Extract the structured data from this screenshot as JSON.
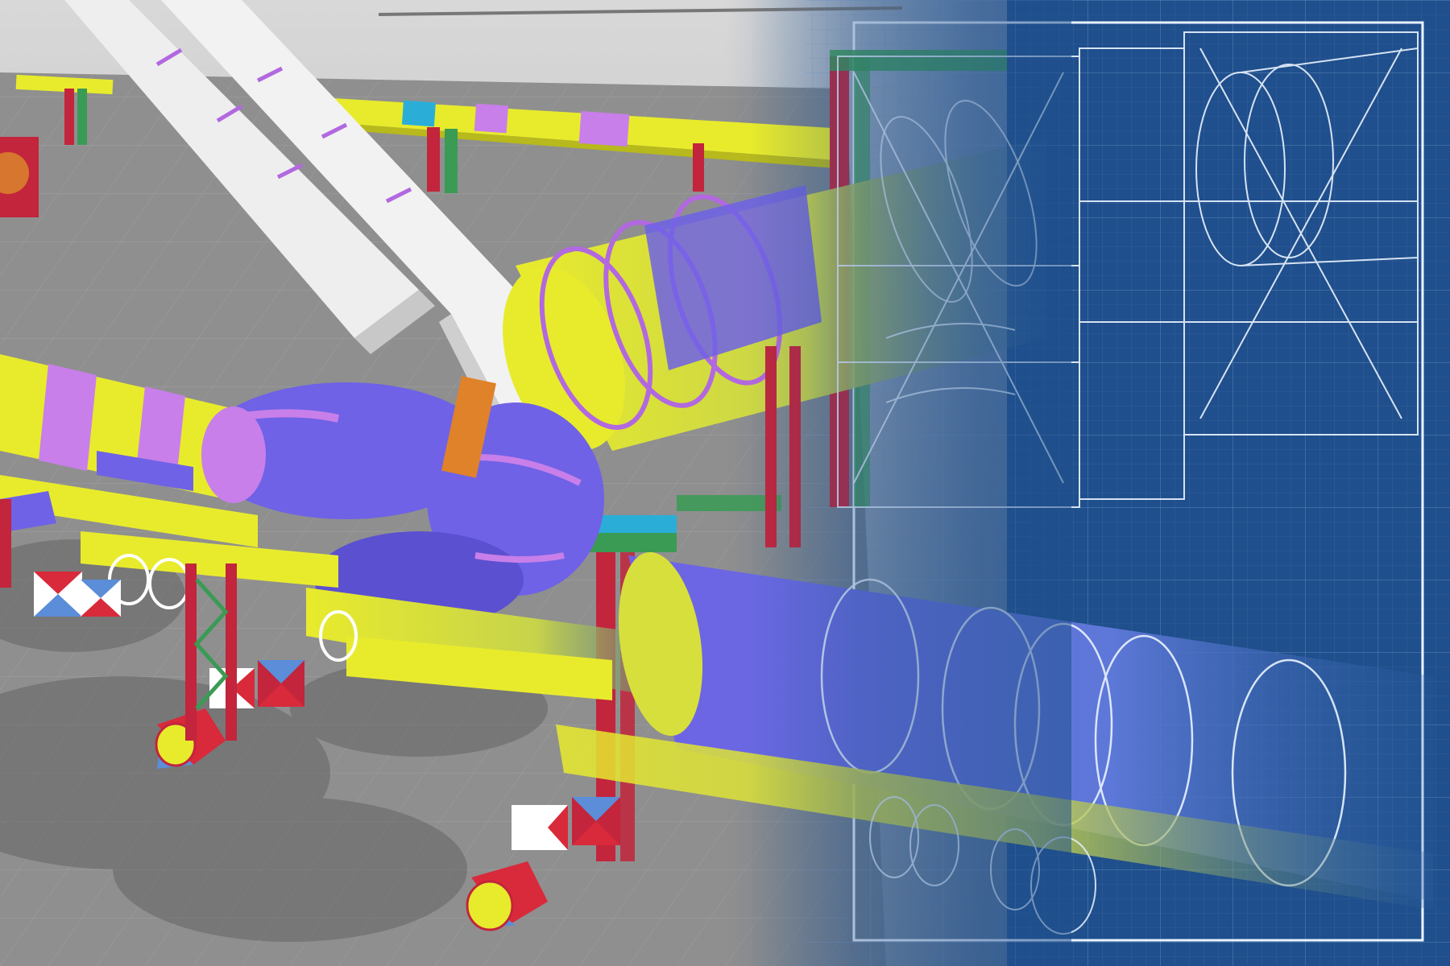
{
  "image": {
    "subject": "industrial-piping-3d-model-to-blueprint-transition",
    "has_visible_text": false
  },
  "palette": {
    "sky_top": "#dcdcdc",
    "floor": "#8f8f8f",
    "floor_line": "#a4a4a4",
    "blueprint_bg": "#1f4f8c",
    "blueprint_dark": "#173f74",
    "blueprint_grid": "#5d86bd",
    "blueprint_line": "#eaf3ff",
    "pipe_yellow": "#e8eb2c",
    "pipe_yellow_dark": "#b7b91c",
    "pipe_purple": "#6f62e6",
    "pipe_purple_dark": "#4b3fb8",
    "pipe_violet": "#c87fe9",
    "support_red": "#c2253c",
    "support_green": "#3a9b54",
    "beam_white": "#eeeeee",
    "beam_shadow": "#c8c8c8",
    "duct_red": "#d82a3a",
    "duct_blue": "#5b8dd8",
    "cyan_band": "#2aaed8"
  },
  "icons": [
    "perspective-grid-floor-icon",
    "overhead-beam-icon",
    "pipe-rack-icon",
    "large-duct-icon",
    "blueprint-wireframe-icon"
  ]
}
